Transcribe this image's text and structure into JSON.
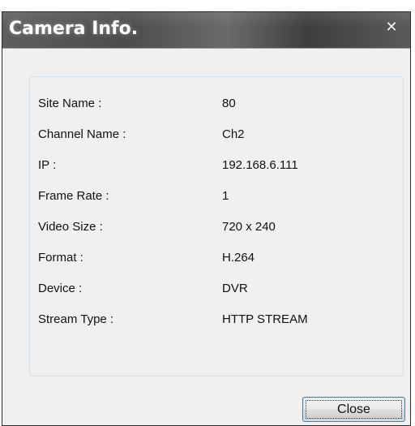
{
  "window": {
    "title": "Camera Info.",
    "close_glyph": "✕"
  },
  "info": {
    "rows": [
      {
        "label": "Site Name :",
        "value": "80"
      },
      {
        "label": "Channel Name :",
        "value": "Ch2"
      },
      {
        "label": "IP :",
        "value": "192.168.6.111"
      },
      {
        "label": "Frame Rate :",
        "value": "1"
      },
      {
        "label": "Video Size :",
        "value": "720 x 240"
      },
      {
        "label": "Format :",
        "value": "H.264"
      },
      {
        "label": "Device :",
        "value": "DVR"
      },
      {
        "label": "Stream Type :",
        "value": "HTTP STREAM"
      }
    ]
  },
  "buttons": {
    "close_label": "Close"
  },
  "colors": {
    "titlebar": "#4c4c4c",
    "dialog_background": "#f0f0f0",
    "button_border": "#3c7fb1"
  },
  "icons": {
    "window_close": "close-icon"
  }
}
